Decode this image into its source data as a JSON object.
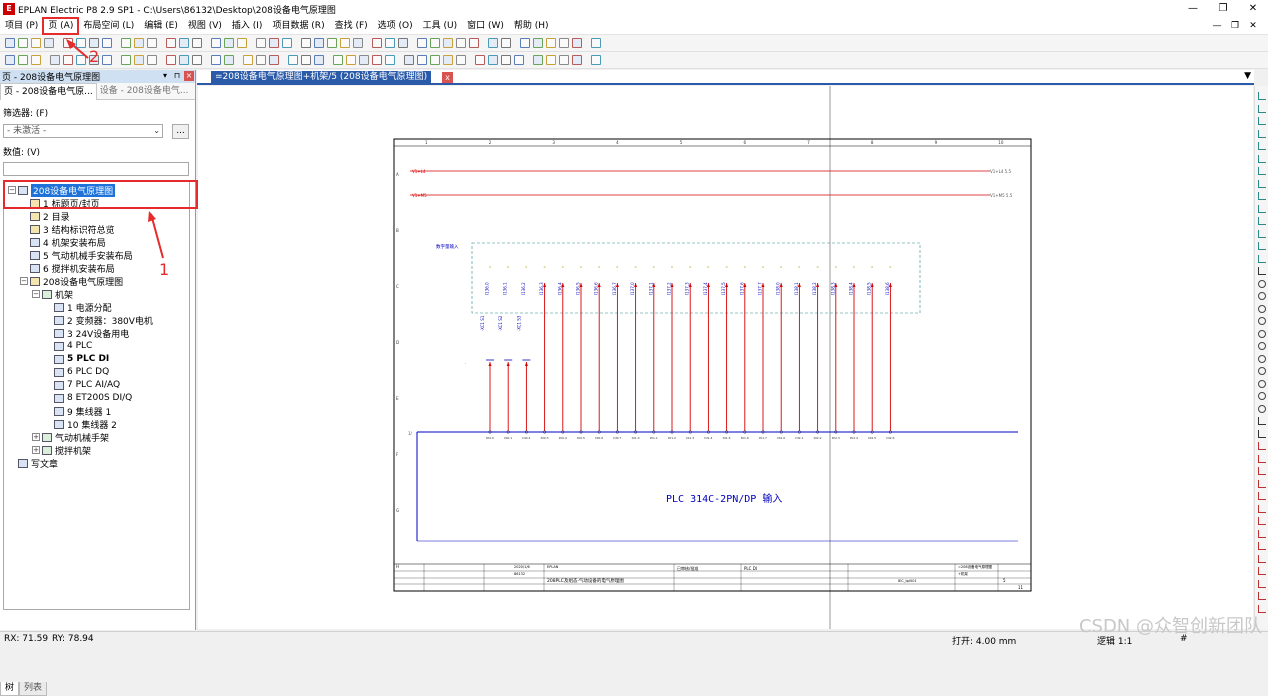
{
  "window": {
    "title": "EPLAN Electric P8 2.9 SP1 - C:\\Users\\86132\\Desktop\\208设备电气原理图",
    "min": "—",
    "max": "❐",
    "close": "✕"
  },
  "menu": [
    "项目 (P)",
    "页 (A)",
    "布局空间 (L)",
    "编辑 (E)",
    "视图 (V)",
    "插入 (I)",
    "项目数据 (R)",
    "查找 (F)",
    "选项 (O)",
    "工具 (U)",
    "窗口 (W)",
    "帮助 (H)"
  ],
  "panel": {
    "title": "页 - 208设备电气原理图",
    "tabs": [
      "页 - 208设备电气原...",
      "设备 - 208设备电气..."
    ],
    "filter_label": "筛选器: (F)",
    "filter_value": "- 未激活 -",
    "dots": "...",
    "number_label": "数值: (V)",
    "tree": [
      {
        "label": "208设备电气原理图",
        "level": 0,
        "toggle": "−",
        "icon": "b",
        "selected": true
      },
      {
        "label": "1 标题页/封页",
        "level": 1,
        "icon": "y"
      },
      {
        "label": "2 目录",
        "level": 1,
        "icon": "y"
      },
      {
        "label": "3 结构标识符总览",
        "level": 1,
        "icon": "y"
      },
      {
        "label": "4 机架安装布局",
        "level": 1,
        "icon": "b"
      },
      {
        "label": "5 气动机械手安装布局",
        "level": 1,
        "icon": "b"
      },
      {
        "label": "6 搅拌机安装布局",
        "level": 1,
        "icon": "b"
      },
      {
        "label": "208设备电气原理图",
        "level": 1,
        "toggle": "−",
        "icon": "y"
      },
      {
        "label": "机架",
        "level": 2,
        "toggle": "−",
        "icon": "g"
      },
      {
        "label": "1 电源分配",
        "level": 3,
        "icon": "b"
      },
      {
        "label": "2 变频器：380V电机",
        "level": 3,
        "icon": "b"
      },
      {
        "label": "3 24V设备用电",
        "level": 3,
        "icon": "b"
      },
      {
        "label": "4 PLC",
        "level": 3,
        "icon": "b"
      },
      {
        "label": "5 PLC DI",
        "level": 3,
        "icon": "b",
        "bold": true
      },
      {
        "label": "6 PLC DQ",
        "level": 3,
        "icon": "b"
      },
      {
        "label": "7 PLC AI/AQ",
        "level": 3,
        "icon": "b"
      },
      {
        "label": "8 ET200S DI/Q",
        "level": 3,
        "icon": "b"
      },
      {
        "label": "9 集线器 1",
        "level": 3,
        "icon": "b"
      },
      {
        "label": "10 集线器 2",
        "level": 3,
        "icon": "b"
      },
      {
        "label": "气动机械手架",
        "level": 2,
        "toggle": "+",
        "icon": "g"
      },
      {
        "label": "搅拌机架",
        "level": 2,
        "toggle": "+",
        "icon": "g"
      },
      {
        "label": "写文章",
        "level": 0,
        "icon": "b"
      }
    ],
    "bottom_tabs": [
      "树",
      "列表"
    ]
  },
  "document": {
    "tab": "=208设备电气原理图+机架/5 (208设备电气原理图)",
    "close": "x",
    "menu": "▼",
    "plc_label": "PLC 314C-2PN/DP 输入",
    "group_label": "数字量输入",
    "columns": [
      "1",
      "2",
      "3",
      "4",
      "5",
      "6",
      "7",
      "8",
      "9",
      "10"
    ],
    "rows": [
      "A",
      "B",
      "C",
      "D",
      "E",
      "F",
      "G",
      "H"
    ],
    "input_labels": [
      "I136.0",
      "I136.1",
      "I136.2",
      "I136.3",
      "I136.4",
      "I136.5",
      "I136.6",
      "I136.7",
      "I137.0",
      "I137.1",
      "I137.2",
      "I137.3",
      "I137.4",
      "I137.5",
      "I137.6",
      "I137.7",
      "I138.0",
      "I138.1",
      "I138.2",
      "I138.3",
      "I138.4",
      "I138.5",
      "I138.6"
    ],
    "terminal_labels": [
      "DI0.0",
      "DI0.1",
      "DI0.2",
      "DI0.3",
      "DI0.4",
      "DI0.5",
      "DI0.6",
      "DI0.7",
      "DI1.0",
      "DI1.1",
      "DI1.2",
      "DI1.3",
      "DI1.4",
      "DI1.5",
      "DI1.6",
      "DI1.7",
      "DI2.0",
      "DI2.1",
      "DI2.2",
      "DI2.3",
      "DI2.4",
      "DI2.5",
      "DI2.6"
    ],
    "sensor_labels": [
      "-XC1 S1",
      "-XC1 S2",
      "-XC1 S3"
    ],
    "top_left_1": "V1+L4",
    "top_right_1": "V1+L4 5.5",
    "top_left_2": "V1+M5",
    "top_right_2": "V1+M5 5.5",
    "title_block": {
      "project": "208PLC及组态·气动设备的电气原理图",
      "company": "EPLAN",
      "page": "5",
      "total": "11",
      "plc": "PLC DI",
      "date": "2020/1/6",
      "drawn": "86132",
      "standard": "IEC_tpl001",
      "check": "已审核/批准",
      "hl1": "=208设备电气原理图",
      "hl2": "+机架"
    }
  },
  "status": {
    "rx": "RX: 71.59",
    "ry": "RY: 78.94",
    "grid": "打开: 4.00 mm",
    "logic": "逻辑 1:1",
    "hash": "#"
  },
  "annotations": {
    "n1": "1",
    "n2": "2"
  },
  "watermark": "CSDN @众智创新团队",
  "colors": {
    "accent": "#2a5aa8",
    "red": "#e52b2b",
    "wire_red": "#d60000",
    "wire_blue": "#0000c0"
  }
}
